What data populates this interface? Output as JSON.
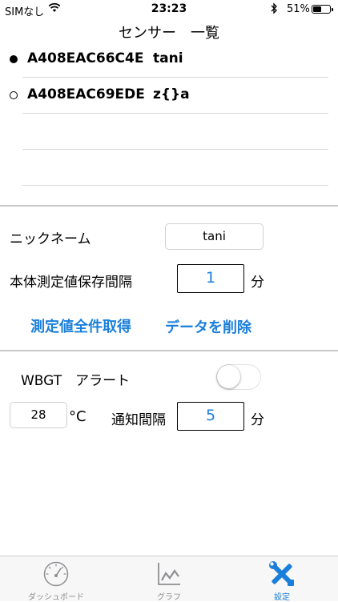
{
  "status_bar": {
    "carrier": "SIMなし",
    "time": "23:23",
    "battery_percent": "51%",
    "battery_level": 0.51
  },
  "nav": {
    "title": "センサー　一覧"
  },
  "sensors": [
    {
      "id": "A408EAC66C4E",
      "nickname": "tani",
      "selected": true
    },
    {
      "id": "A408EAC69EDE",
      "nickname": "z{}a",
      "selected": false
    }
  ],
  "settings": {
    "nickname_label": "ニックネーム",
    "nickname_value": "tani",
    "interval_label": "本体測定値保存間隔",
    "interval_value": "1",
    "interval_unit": "分",
    "fetch_all_label": "測定値全件取得",
    "delete_data_label": "データを削除"
  },
  "alert": {
    "label": "WBGT　アラート",
    "enabled": false,
    "threshold_value": "28",
    "threshold_unit": "°C",
    "notify_label": "通知間隔",
    "notify_value": "5",
    "notify_unit": "分"
  },
  "tabs": [
    {
      "label": "ダッシュボード",
      "icon": "gauge-icon",
      "active": false
    },
    {
      "label": "グラフ",
      "icon": "chart-icon",
      "active": false
    },
    {
      "label": "設定",
      "icon": "tools-icon",
      "active": true
    }
  ],
  "colors": {
    "accent": "#1a7fdb",
    "inactive": "#8e8e93"
  }
}
